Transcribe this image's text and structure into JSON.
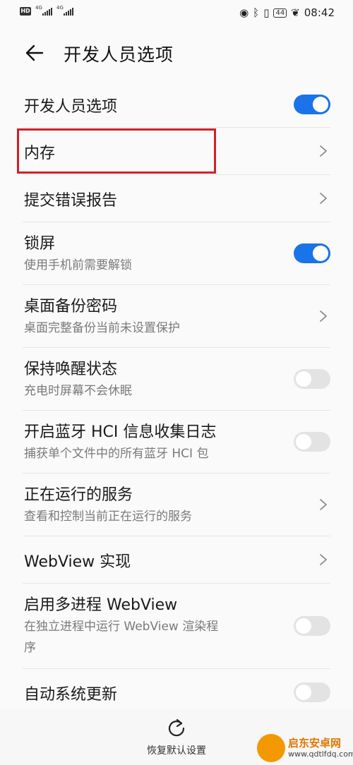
{
  "status_bar": {
    "hd_label": "HD",
    "network_1": "4G",
    "network_2": "4G",
    "battery": "44",
    "time": "08:42"
  },
  "header": {
    "title": "开发人员选项"
  },
  "settings": [
    {
      "title": "开发人员选项",
      "subtitle": "",
      "control": "toggle",
      "state": "on"
    },
    {
      "title": "内存",
      "subtitle": "",
      "control": "chevron"
    },
    {
      "title": "提交错误报告",
      "subtitle": "",
      "control": "chevron"
    },
    {
      "title": "锁屏",
      "subtitle": "使用手机前需要解锁",
      "control": "toggle",
      "state": "on"
    },
    {
      "title": "桌面备份密码",
      "subtitle": "桌面完整备份当前未设置保护",
      "control": "chevron"
    },
    {
      "title": "保持唤醒状态",
      "subtitle": "充电时屏幕不会休眠",
      "control": "toggle",
      "state": "off"
    },
    {
      "title": "开启蓝牙 HCI 信息收集日志",
      "subtitle": "捕获单个文件中的所有蓝牙 HCI 包",
      "control": "toggle",
      "state": "off"
    },
    {
      "title": "正在运行的服务",
      "subtitle": "查看和控制当前正在运行的服务",
      "control": "chevron"
    },
    {
      "title": "WebView 实现",
      "subtitle": "",
      "control": "chevron"
    },
    {
      "title": "启用多进程 WebView",
      "subtitle": "在独立进程中运行 WebView 渲染程",
      "subtitle2": "序",
      "control": "toggle",
      "state": "off"
    },
    {
      "title": "自动系统更新",
      "subtitle": "",
      "control": "toggle",
      "state": "off"
    }
  ],
  "footer": {
    "reset_label": "恢复默认设置"
  },
  "watermark": {
    "name": "启东安卓网",
    "url": "www.qdtlfdq.com"
  },
  "colors": {
    "accent": "#1a73e8",
    "highlight": "#d1202a"
  }
}
